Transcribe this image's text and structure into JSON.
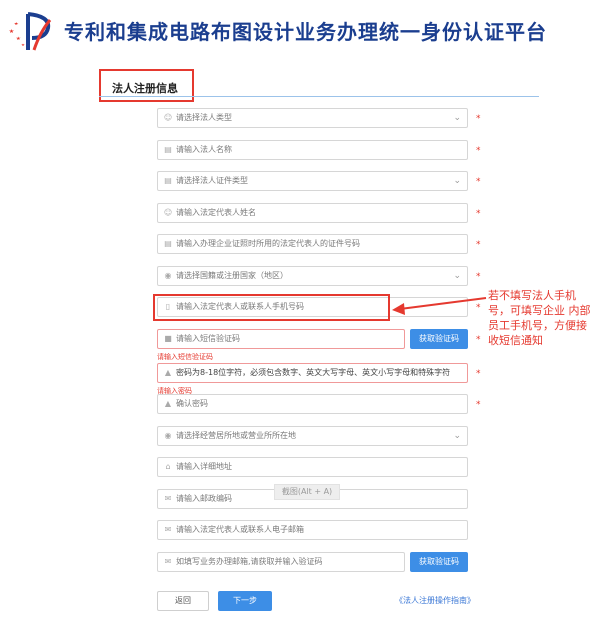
{
  "header": {
    "title": "专利和集成电路布图设计业务办理统一身份认证平台"
  },
  "section": {
    "title": "法人注册信息"
  },
  "fields": {
    "legal_type": "请选择法人类型",
    "legal_name": "请输入法人名称",
    "cert_type": "请选择法人证件类型",
    "rep_name": "请输入法定代表人姓名",
    "rep_id": "请输入办理企业证照时所用的法定代表人的证件号码",
    "country": "请选择国籍或注册国家（地区）",
    "phone": "请输入法定代表人或联系人手机号码",
    "sms_code": "请输入短信验证码",
    "sms_error": "请输入短信验证码",
    "password": "密码为8-18位字符，必须包含数字、英文大写字母、英文小写字母和特殊字符",
    "password_error": "请输入密码",
    "confirm_password": "确认密码",
    "region": "请选择经营居所地或营业所所在地",
    "address": "请输入详细地址",
    "postcode": "请输入邮政编码",
    "email": "请输入法定代表人或联系人电子邮箱",
    "biz_email": "如填写业务办理邮箱,请获取并输入验证码"
  },
  "required_mark": "*",
  "buttons": {
    "get_code_1": "获取验证码",
    "get_code_2": "获取验证码",
    "back": "返回",
    "next": "下一步"
  },
  "annotation": {
    "note": "若不填写法人手机号，可填写企业 内部员工手机号，方便接收短信通知"
  },
  "overlay": {
    "screenshot_hint": "截图(Alt + A)"
  },
  "links": {
    "guide": "《法人注册操作指南》"
  },
  "colors": {
    "brand": "#1b3e8f",
    "accent": "#3d8ee6",
    "alert": "#e5392f"
  }
}
